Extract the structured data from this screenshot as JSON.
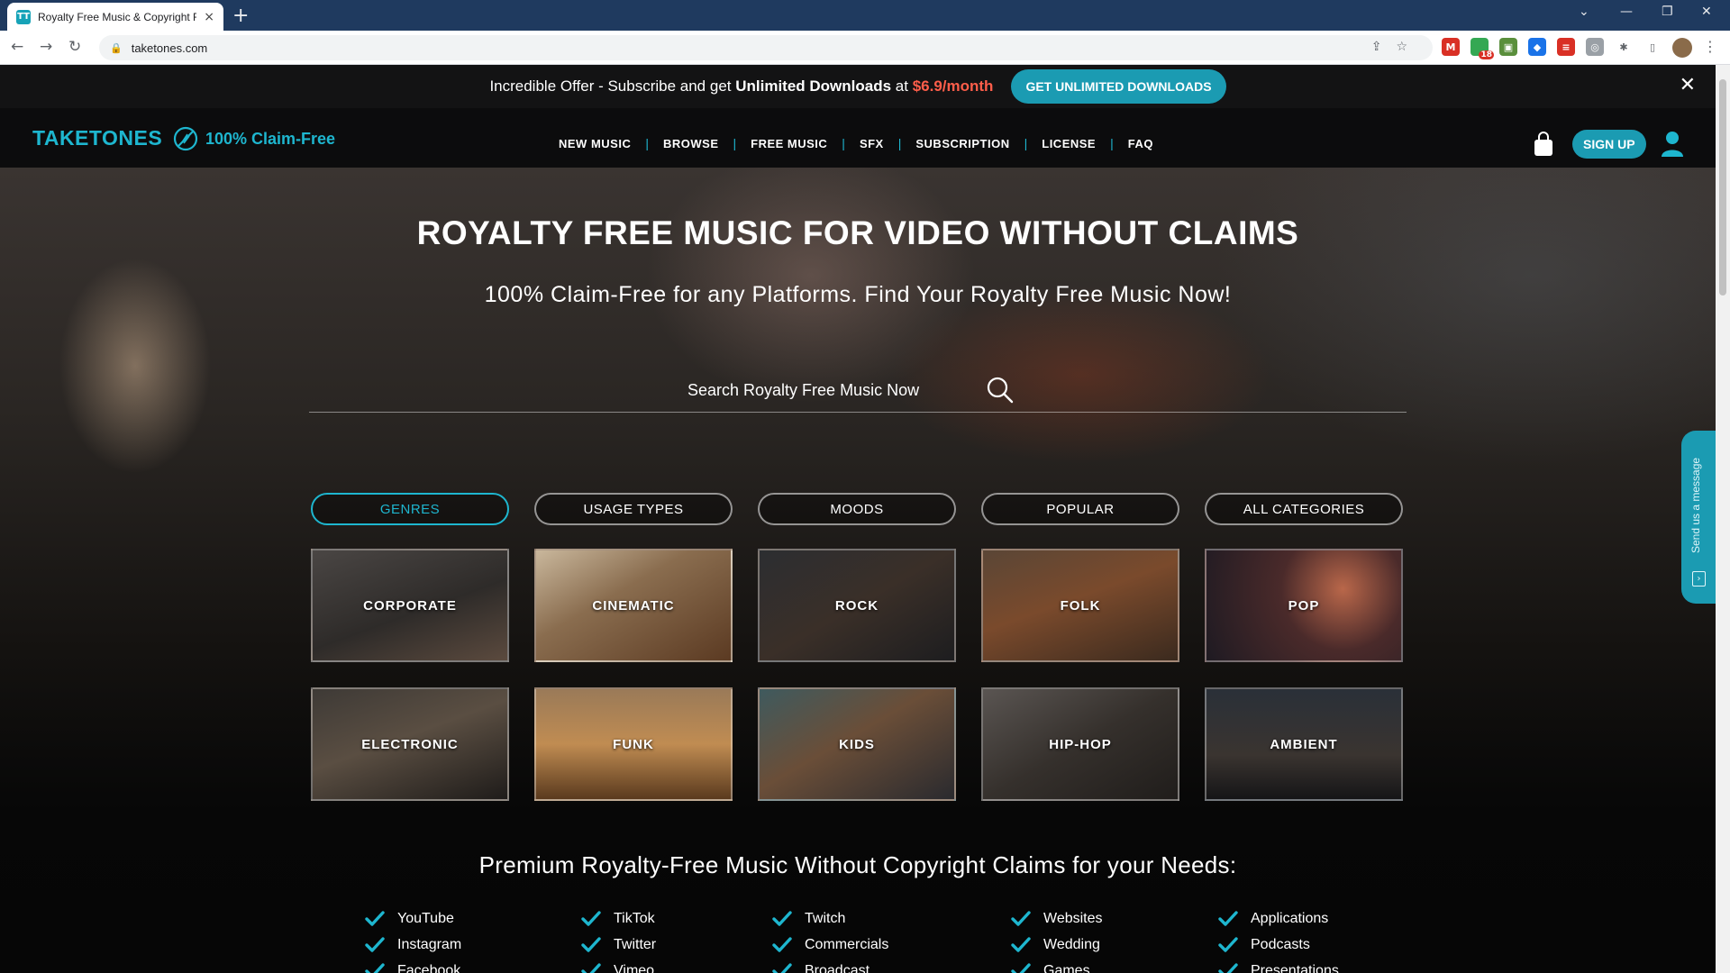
{
  "browser": {
    "tab_title": "Royalty Free Music & Copyright F",
    "tab_favicon": "TT",
    "new_tab": "+",
    "close_tab": "×",
    "url": "taketones.com",
    "ext_badge": "18"
  },
  "promo": {
    "text_lead": "Incredible Offer - Subscribe and get ",
    "text_bold": "Unlimited Downloads",
    "text_mid": " at ",
    "price": "$6.9/month",
    "button": "GET UNLIMITED DOWNLOADS",
    "close": "✕"
  },
  "header": {
    "logo": "TAKETONES",
    "claim_free": "100% Claim-Free",
    "nav": [
      "NEW MUSIC",
      "BROWSE",
      "FREE MUSIC",
      "SFX",
      "SUBSCRIPTION",
      "LICENSE",
      "FAQ"
    ],
    "signup": "SIGN UP"
  },
  "hero": {
    "title": "ROYALTY FREE MUSIC FOR VIDEO WITHOUT CLAIMS",
    "subtitle": "100% Claim-Free for any Platforms. Find Your Royalty Free Music Now!",
    "search_placeholder": "Search Royalty Free Music Now"
  },
  "category_tabs": [
    "GENRES",
    "USAGE TYPES",
    "MOODS",
    "POPULAR",
    "ALL CATEGORIES"
  ],
  "active_tab": "GENRES",
  "genres": [
    "CORPORATE",
    "CINEMATIC",
    "ROCK",
    "FOLK",
    "POP",
    "ELECTRONIC",
    "FUNK",
    "KIDS",
    "HIP-HOP",
    "AMBIENT"
  ],
  "needs": {
    "title": "Premium Royalty-Free Music Without Copyright Claims for your Needs:",
    "items": [
      "YouTube",
      "TikTok",
      "Twitch",
      "Websites",
      "Applications",
      "Instagram",
      "Twitter",
      "Commercials",
      "Wedding",
      "Podcasts",
      "Facebook",
      "Vimeo",
      "Broadcast",
      "Games",
      "Presentations"
    ]
  },
  "chat_widget": {
    "label": "Send us a message"
  },
  "colors": {
    "accent": "#1eb6cf",
    "price": "#ff5e4a",
    "button": "#1b9bb2",
    "tabbar": "#1f3a5f"
  }
}
